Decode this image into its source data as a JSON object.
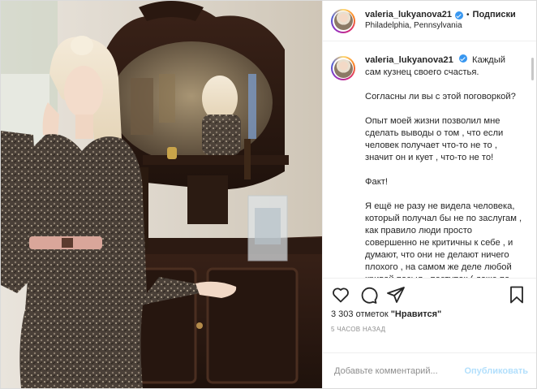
{
  "post": {
    "username": "valeria_lukyanova21",
    "follow_separator": "•",
    "follow_label": "Подписки",
    "location": "Philadelphia, Pennsylvania",
    "photo_subject": "woman in patterned dress beside antique mirror sideboard"
  },
  "caption": {
    "username": "valeria_lukyanova21",
    "paragraphs": [
      "Каждый сам кузнец своего счастья.",
      "Согласны ли вы с этой поговоркой?",
      "Опыт моей жизни позволил мне сделать выводы о том , что если человек получает что-то не то , значит он и кует , что-то не то!",
      "Факт!",
      "Я ещё не разу не видела человека, который получал бы не по заслугам , как правило люди просто совершенно не критичны к себе , и думают, что они не делают ничего плохого , на самом же деле любой кривой посыл , поступок ( даже по отношению к себе) — искривляет"
    ]
  },
  "actions": {
    "like_icon": "heart-icon",
    "comment_icon": "comment-icon",
    "share_icon": "share-icon",
    "save_icon": "bookmark-icon"
  },
  "likes_text_prefix": "3 303 отметок ",
  "likes_text_bold": "\"Нравится\"",
  "timestamp": "5 часов назад",
  "comment_input": {
    "placeholder": "Добавьте комментарий...",
    "value": ""
  },
  "publish_label": "Опубликовать",
  "colors": {
    "verified": "#3897f0",
    "publish_disabled": "#b2dffc",
    "meta_gray": "#8e8e8e"
  }
}
